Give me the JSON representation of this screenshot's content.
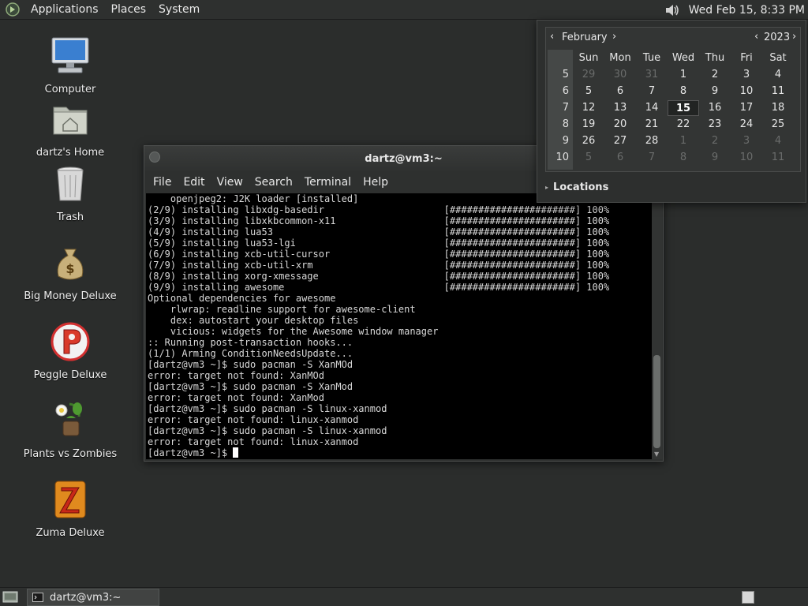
{
  "top_panel": {
    "menus": [
      "Applications",
      "Places",
      "System"
    ],
    "clock": "Wed Feb 15,  8:33 PM",
    "icons": [
      "distro-logo-icon",
      "volume-icon"
    ]
  },
  "desktop_icons": [
    {
      "label": "Computer",
      "icon": "computer-icon"
    },
    {
      "label": "dartz's Home",
      "icon": "home-folder-icon"
    },
    {
      "label": "Trash",
      "icon": "trash-icon"
    },
    {
      "label": "Big Money Deluxe",
      "icon": "money-bag-icon"
    },
    {
      "label": "Peggle Deluxe",
      "icon": "peggle-icon"
    },
    {
      "label": "Plants vs Zombies",
      "icon": "plants-vs-zombies-icon"
    },
    {
      "label": "Zuma Deluxe",
      "icon": "zuma-icon"
    }
  ],
  "terminal": {
    "title": "dartz@vm3:~",
    "menu": [
      "File",
      "Edit",
      "View",
      "Search",
      "Terminal",
      "Help"
    ],
    "lines": [
      "    openjpeg2: J2K loader [installed]",
      "(2/9) installing libxdg-basedir                     [######################] 100%",
      "(3/9) installing libxkbcommon-x11                   [######################] 100%",
      "(4/9) installing lua53                              [######################] 100%",
      "(5/9) installing lua53-lgi                          [######################] 100%",
      "(6/9) installing xcb-util-cursor                    [######################] 100%",
      "(7/9) installing xcb-util-xrm                       [######################] 100%",
      "(8/9) installing xorg-xmessage                      [######################] 100%",
      "(9/9) installing awesome                            [######################] 100%",
      "Optional dependencies for awesome",
      "    rlwrap: readline support for awesome-client",
      "    dex: autostart your desktop files",
      "    vicious: widgets for the Awesome window manager",
      ":: Running post-transaction hooks...",
      "(1/1) Arming ConditionNeedsUpdate...",
      "[dartz@vm3 ~]$ sudo pacman -S XanMOd",
      "error: target not found: XanMOd",
      "[dartz@vm3 ~]$ sudo pacman -S XanMod",
      "error: target not found: XanMod",
      "[dartz@vm3 ~]$ sudo pacman -S linux-xanmod",
      "error: target not found: linux-xanmod",
      "[dartz@vm3 ~]$ sudo pacman -S linux-xanmod",
      "error: target not found: linux-xanmod"
    ],
    "prompt": "[dartz@vm3 ~]$ "
  },
  "calendar": {
    "month": "February",
    "year": "2023",
    "weekdays": [
      "Sun",
      "Mon",
      "Tue",
      "Wed",
      "Thu",
      "Fri",
      "Sat"
    ],
    "weeks": [
      {
        "num": "5",
        "days": [
          [
            "29",
            true
          ],
          [
            "30",
            true
          ],
          [
            "31",
            true
          ],
          [
            "1",
            false
          ],
          [
            "2",
            false
          ],
          [
            "3",
            false
          ],
          [
            "4",
            false
          ]
        ]
      },
      {
        "num": "6",
        "days": [
          [
            "5",
            false
          ],
          [
            "6",
            false
          ],
          [
            "7",
            false
          ],
          [
            "8",
            false
          ],
          [
            "9",
            false
          ],
          [
            "10",
            false
          ],
          [
            "11",
            false
          ]
        ]
      },
      {
        "num": "7",
        "days": [
          [
            "12",
            false
          ],
          [
            "13",
            false
          ],
          [
            "14",
            false
          ],
          [
            "15",
            false
          ],
          [
            "16",
            false
          ],
          [
            "17",
            false
          ],
          [
            "18",
            false
          ]
        ]
      },
      {
        "num": "8",
        "days": [
          [
            "19",
            false
          ],
          [
            "20",
            false
          ],
          [
            "21",
            false
          ],
          [
            "22",
            false
          ],
          [
            "23",
            false
          ],
          [
            "24",
            false
          ],
          [
            "25",
            false
          ]
        ]
      },
      {
        "num": "9",
        "days": [
          [
            "26",
            false
          ],
          [
            "27",
            false
          ],
          [
            "28",
            false
          ],
          [
            "1",
            true
          ],
          [
            "2",
            true
          ],
          [
            "3",
            true
          ],
          [
            "4",
            true
          ]
        ]
      },
      {
        "num": "10",
        "days": [
          [
            "5",
            true
          ],
          [
            "6",
            true
          ],
          [
            "7",
            true
          ],
          [
            "8",
            true
          ],
          [
            "9",
            true
          ],
          [
            "10",
            true
          ],
          [
            "11",
            true
          ]
        ]
      }
    ],
    "today": "15",
    "locations_label": "Locations"
  },
  "bottom_panel": {
    "task_label": "dartz@vm3:~",
    "icons": [
      "show-desktop-icon",
      "terminal-icon",
      "workspace-switcher-icon"
    ]
  }
}
